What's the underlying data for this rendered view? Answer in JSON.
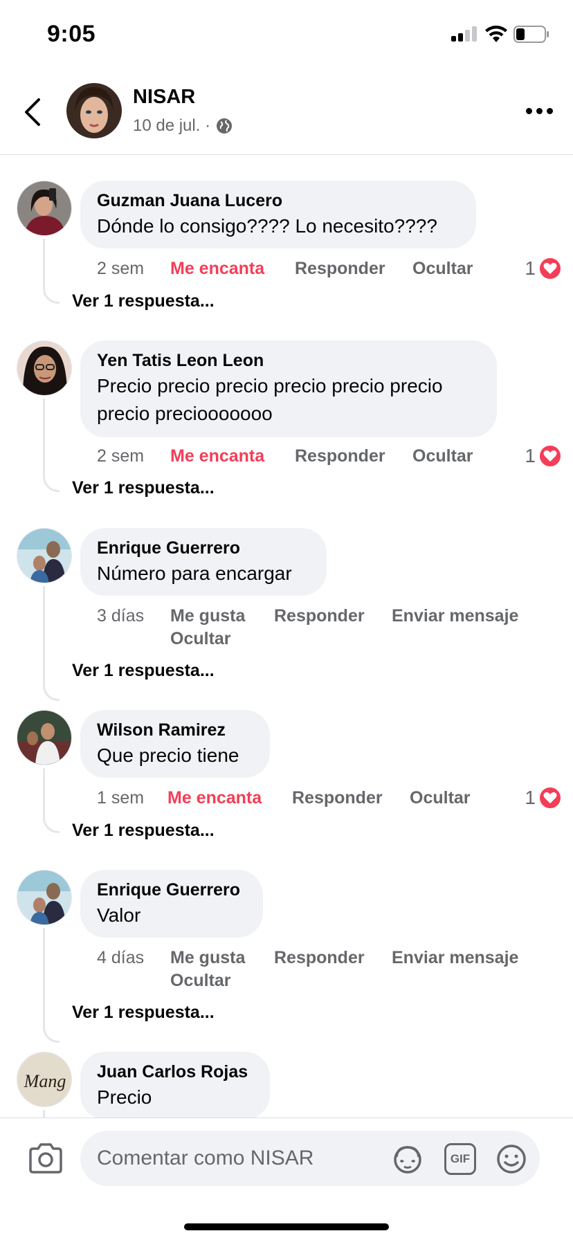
{
  "status_bar": {
    "time": "9:05"
  },
  "header": {
    "name": "NISAR",
    "date": "10 de jul. ·",
    "privacy_icon": "globe-icon"
  },
  "comments": [
    {
      "author": "Guzman Juana Lucero",
      "text": "Dónde lo consigo???? Lo necesito????",
      "time": "2 sem",
      "reaction_label": "Me encanta",
      "reply_label": "Responder",
      "hide_label": "Ocultar",
      "reaction_count": "1",
      "replies_label": "Ver 1 respuesta..."
    },
    {
      "author": "Yen Tatis Leon Leon",
      "text": "Precio precio precio precio precio precio precio preciooooooo",
      "time": "2 sem",
      "reaction_label": "Me encanta",
      "reply_label": "Responder",
      "hide_label": "Ocultar",
      "reaction_count": "1",
      "replies_label": "Ver 1 respuesta..."
    },
    {
      "author": "Enrique Guerrero",
      "text": "Número para encargar",
      "time": "3 días",
      "like_label": "Me gusta",
      "reply_label": "Responder",
      "message_label": "Enviar mensaje",
      "hide_label": "Ocultar",
      "replies_label": "Ver 1 respuesta..."
    },
    {
      "author": "Wilson Ramirez",
      "text": "Que precio tiene",
      "time": "1 sem",
      "reaction_label": "Me encanta",
      "reply_label": "Responder",
      "hide_label": "Ocultar",
      "reaction_count": "1",
      "replies_label": "Ver 1 respuesta..."
    },
    {
      "author": "Enrique Guerrero",
      "text": "Valor",
      "time": "4 días",
      "like_label": "Me gusta",
      "reply_label": "Responder",
      "message_label": "Enviar mensaje",
      "hide_label": "Ocultar",
      "replies_label": "Ver 1 respuesta..."
    },
    {
      "author": "Juan Carlos Rojas",
      "text": "Precio",
      "avatar_text": "Mang"
    }
  ],
  "composer": {
    "placeholder": "Comentar como NISAR",
    "gif_label": "GIF"
  },
  "colors": {
    "love": "#f33e58",
    "secondary_text": "#65676b",
    "bubble": "#f0f2f5"
  }
}
